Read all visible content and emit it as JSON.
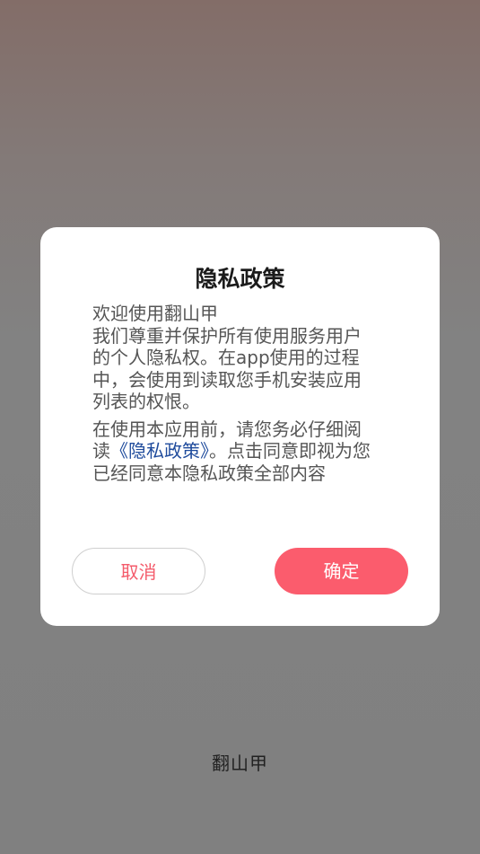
{
  "app": {
    "name": "翻山甲"
  },
  "dialog": {
    "title": "隐私政策",
    "greeting": "欢迎使用翻山甲",
    "paragraph1": "我们尊重并保护所有使用服务用户的个人隐私权。在app使用的过程中，会使用到读取您手机安装应用列表的权恨。",
    "paragraph2_before": "在使用本应用前，请您务必仔细阅读",
    "paragraph2_link": "《隐私政策》",
    "paragraph2_after": "。点击同意即视为您已经同意本隐私政策全部内容",
    "cancel_label": "取消",
    "confirm_label": "确定"
  },
  "colors": {
    "accent": "#fb5c6d",
    "link": "#1f4b9c",
    "backdrop": "#808080"
  }
}
